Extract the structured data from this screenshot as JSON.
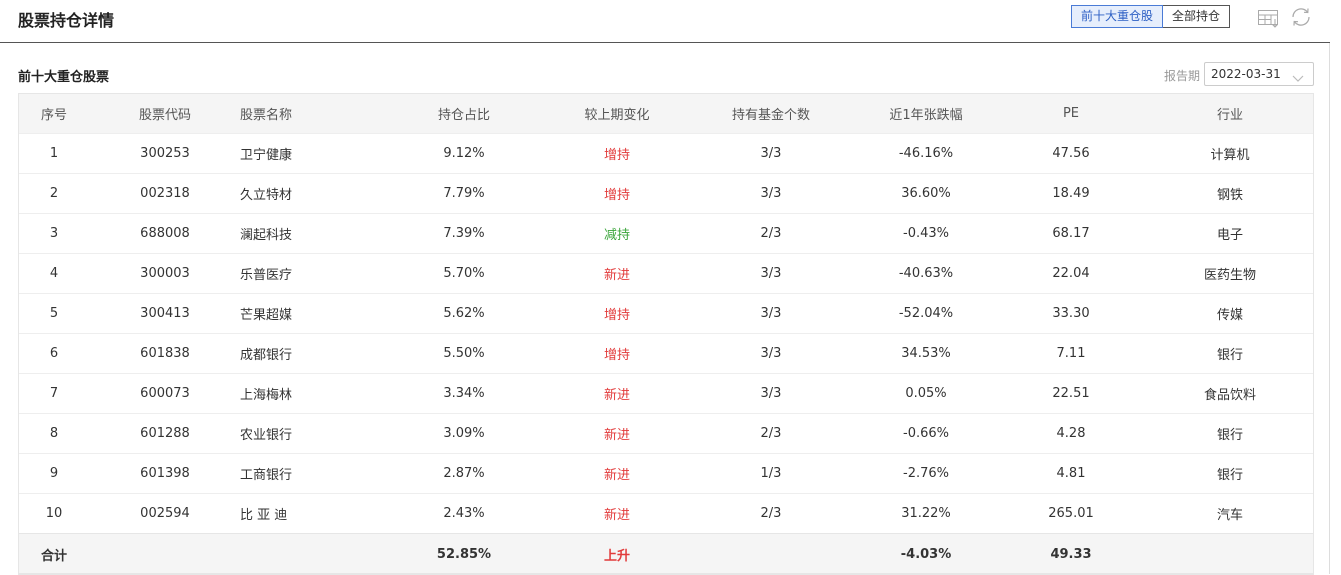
{
  "header": {
    "title": "股票持仓详情",
    "tabs": [
      {
        "label": "前十大重仓股",
        "active": true
      },
      {
        "label": "全部持仓",
        "active": false
      }
    ],
    "icons": [
      "table-download-icon",
      "refresh-icon"
    ]
  },
  "section": {
    "title": "前十大重仓股票",
    "report_label": "报告期",
    "report_date": "2022-03-31"
  },
  "colors": {
    "up": "#e23b3b",
    "down": "#3aa53a",
    "accent": "#4a7bd6"
  },
  "table": {
    "columns": [
      "序号",
      "股票代码",
      "股票名称",
      "持仓占比",
      "较上期变化",
      "持有基金个数",
      "近1年张跌幅",
      "PE",
      "行业"
    ],
    "rows": [
      [
        "1",
        "300253",
        "卫宁健康",
        "9.12%",
        "增持",
        "3/3",
        "-46.16%",
        "47.56",
        "计算机"
      ],
      [
        "2",
        "002318",
        "久立特材",
        "7.79%",
        "增持",
        "3/3",
        "36.60%",
        "18.49",
        "钢铁"
      ],
      [
        "3",
        "688008",
        "澜起科技",
        "7.39%",
        "减持",
        "2/3",
        "-0.43%",
        "68.17",
        "电子"
      ],
      [
        "4",
        "300003",
        "乐普医疗",
        "5.70%",
        "新进",
        "3/3",
        "-40.63%",
        "22.04",
        "医药生物"
      ],
      [
        "5",
        "300413",
        "芒果超媒",
        "5.62%",
        "增持",
        "3/3",
        "-52.04%",
        "33.30",
        "传媒"
      ],
      [
        "6",
        "601838",
        "成都银行",
        "5.50%",
        "增持",
        "3/3",
        "34.53%",
        "7.11",
        "银行"
      ],
      [
        "7",
        "600073",
        "上海梅林",
        "3.34%",
        "新进",
        "3/3",
        "0.05%",
        "22.51",
        "食品饮料"
      ],
      [
        "8",
        "601288",
        "农业银行",
        "3.09%",
        "新进",
        "2/3",
        "-0.66%",
        "4.28",
        "银行"
      ],
      [
        "9",
        "601398",
        "工商银行",
        "2.87%",
        "新进",
        "1/3",
        "-2.76%",
        "4.81",
        "银行"
      ],
      [
        "10",
        "002594",
        "比 亚 迪",
        "2.43%",
        "新进",
        "2/3",
        "31.22%",
        "265.01",
        "汽车"
      ]
    ],
    "total": [
      "合计",
      "",
      "",
      "52.85%",
      "上升",
      "",
      "-4.03%",
      "49.33",
      ""
    ]
  }
}
